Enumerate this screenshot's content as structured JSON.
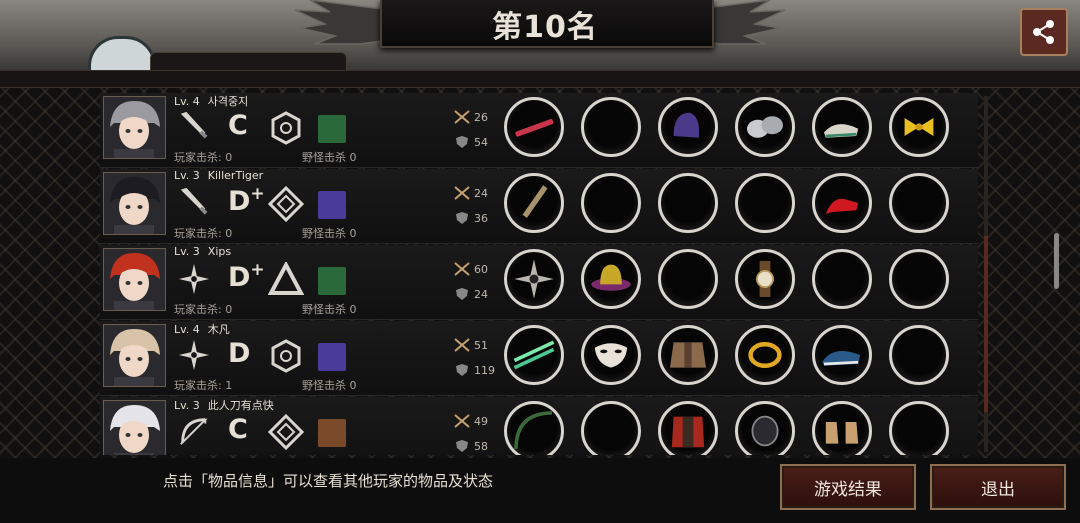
{
  "header": {
    "title": "第10名",
    "share_icon": "share-icon"
  },
  "stats_icons": {
    "kills": "crossed-swords-icon",
    "defense": "shield-icon"
  },
  "players": [
    {
      "level": "Lv. 4",
      "name": "사격중지",
      "grade": "C",
      "grade_plus": "",
      "player_kills_label": "玩家击杀: 0",
      "monster_kills_label": "野怪击杀 0",
      "attack": "26",
      "defense": "54",
      "weapon_icon": "knife-icon",
      "skill_icon": "hexagon-rune-icon",
      "avatar_hair": "#9a9aa0",
      "items": [
        "red-rifle-icon",
        "",
        "purple-helmet-icon",
        "silver-gauntlet-icon",
        "green-shoes-icon",
        "gold-ribbon-icon"
      ]
    },
    {
      "level": "Lv. 3",
      "name": "KillerTiger",
      "grade": "D",
      "grade_plus": "+",
      "player_kills_label": "玩家击杀: 0",
      "monster_kills_label": "野怪击杀 0",
      "attack": "24",
      "defense": "36",
      "weapon_icon": "knife-icon",
      "skill_icon": "diamond-rune-icon",
      "avatar_hair": "#1c1c22",
      "items": [
        "dagger-icon",
        "",
        "",
        "",
        "red-heels-icon",
        ""
      ]
    },
    {
      "level": "Lv. 3",
      "name": "Xips",
      "grade": "D",
      "grade_plus": "+",
      "player_kills_label": "玩家击杀: 0",
      "monster_kills_label": "野怪击杀 0",
      "attack": "60",
      "defense": "24",
      "weapon_icon": "shuriken-icon",
      "skill_icon": "triangle-rune-icon",
      "avatar_hair": "#c0321e",
      "items": [
        "shuriken-item-icon",
        "purple-hat-icon",
        "",
        "wristwatch-icon",
        "",
        ""
      ]
    },
    {
      "level": "Lv. 4",
      "name": "木凡",
      "grade": "D",
      "grade_plus": "",
      "player_kills_label": "玩家击杀: 1",
      "monster_kills_label": "野怪击杀 0",
      "attack": "51",
      "defense": "119",
      "weapon_icon": "shuriken-icon",
      "skill_icon": "hexagon-rune-icon",
      "avatar_hair": "#d8c2a8",
      "items": [
        "twin-green-blades-icon",
        "white-mask-icon",
        "leather-armor-icon",
        "gold-bracelet-icon",
        "blue-sneakers-icon",
        ""
      ]
    },
    {
      "level": "Lv. 3",
      "name": "此人刀有点快",
      "grade": "C",
      "grade_plus": "",
      "player_kills_label": "玩家击杀: 0",
      "monster_kills_label": "野怪击杀 0",
      "attack": "49",
      "defense": "58",
      "weapon_icon": "bow-icon",
      "skill_icon": "diamond-rune-icon",
      "avatar_hair": "#e4e4ea",
      "items": [
        "bow-item-icon",
        "",
        "red-armor-icon",
        "black-gauntlet-icon",
        "tan-boots-icon",
        ""
      ]
    }
  ],
  "footer": {
    "hint": "点击「物品信息」可以查看其他玩家的物品及状态",
    "results_button": "游戏结果",
    "exit_button": "退出"
  }
}
